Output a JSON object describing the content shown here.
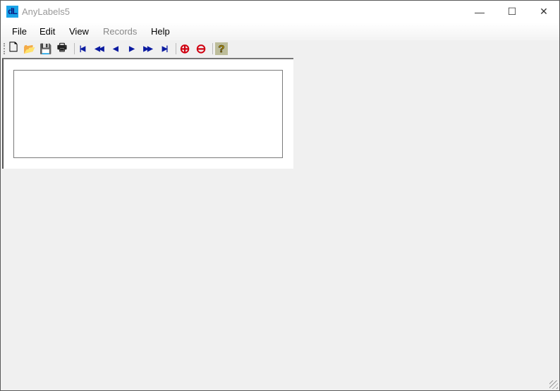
{
  "window": {
    "title": "AnyLabels5",
    "logo_text": "dL",
    "minimize": "—",
    "maximize": "☐",
    "close": "✕"
  },
  "menu": [
    {
      "label": "File"
    },
    {
      "label": "Edit"
    },
    {
      "label": "View"
    },
    {
      "label": "Records",
      "disabled": true
    },
    {
      "label": "Help"
    }
  ],
  "toolbar": {
    "new": "🗋",
    "open": "📂",
    "save": "💾",
    "print": "🖶",
    "first": "|◀",
    "prev_page": "◀◀",
    "prev": "◀",
    "next": "▶",
    "next_page": "▶▶",
    "last": "▶|",
    "add": "⊕",
    "remove": "⊖",
    "help": "?"
  }
}
